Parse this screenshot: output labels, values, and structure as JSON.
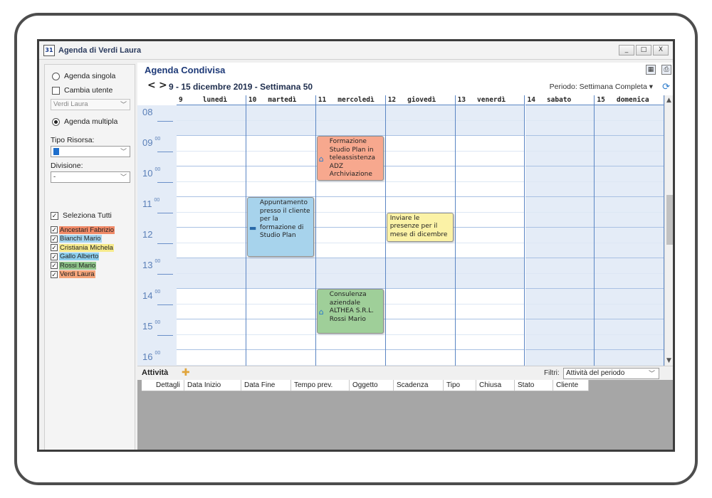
{
  "window": {
    "title": "Agenda di Verdi Laura",
    "app_icon": "31",
    "controls": [
      "_",
      "□",
      "X"
    ]
  },
  "left_panel": {
    "agenda_singola": "Agenda singola",
    "cambia_utente": "Cambia utente",
    "utente_value": "Verdi Laura",
    "agenda_multipla": "Agenda multipla",
    "tipo_risorsa_label": "Tipo Risorsa:",
    "divisione_label": "Divisione:",
    "divisione_value": "-",
    "seleziona_tutti": "Seleziona Tutti",
    "resources": [
      {
        "name": "Ancestari Fabrizio",
        "color": "#f08a68"
      },
      {
        "name": "Bianchi Mario",
        "color": "#a6d4ee"
      },
      {
        "name": "Cristiania Michela",
        "color": "#f6ea8c"
      },
      {
        "name": "Gallo Alberto",
        "color": "#8fd0ee"
      },
      {
        "name": "Rossi Mario",
        "color": "#8ec48a"
      },
      {
        "name": "Verdi Laura",
        "color": "#f4a47a"
      }
    ]
  },
  "header": {
    "title": "Agenda Condivisa",
    "prev": "<",
    "next": ">",
    "date_range": "9 - 15 dicembre 2019 - Settimana 50",
    "periodo": "Periodo:  Settimana Completa ▾"
  },
  "calendar": {
    "days": [
      {
        "num": "9",
        "name": "lunedì"
      },
      {
        "num": "10",
        "name": "martedì"
      },
      {
        "num": "11",
        "name": "mercoledì"
      },
      {
        "num": "12",
        "name": "giovedì"
      },
      {
        "num": "13",
        "name": "venerdì"
      },
      {
        "num": "14",
        "name": "sabato"
      },
      {
        "num": "15",
        "name": "domenica"
      }
    ],
    "hours": [
      {
        "h": "08",
        "m": ""
      },
      {
        "h": "09",
        "m": "00"
      },
      {
        "h": "10",
        "m": "00"
      },
      {
        "h": "11",
        "m": "00"
      },
      {
        "h": "12",
        "m": ""
      },
      {
        "h": "13",
        "m": "00"
      },
      {
        "h": "14",
        "m": "00"
      },
      {
        "h": "15",
        "m": "00"
      },
      {
        "h": "16",
        "m": "00"
      }
    ],
    "events": [
      {
        "text": "Formazione Studio Plan in teleassistenza ADZ Archiviazione",
        "day": "11 mercoledì",
        "start": "09:00",
        "end": "10:30",
        "color": "#f7a88e",
        "icon": "home-icon"
      },
      {
        "text": "Appuntamento presso il cliente per la formazione di Studio Plan",
        "day": "10 martedì",
        "start": "11:00",
        "end": "13:00",
        "color": "#a7d3ec",
        "icon": "briefcase-icon"
      },
      {
        "text": "Inviare le presenze per il mese di dicembre",
        "day": "12 giovedì",
        "start": "11:30",
        "end": "12:30",
        "color": "#fbf2a6",
        "icon": ""
      },
      {
        "text": "Consulenza aziendale ALTHEA S.R.L. Rossi Mario",
        "day": "11 mercoledì",
        "start": "14:00",
        "end": "15:30",
        "color": "#9fcf99",
        "icon": "home-icon"
      }
    ]
  },
  "activity": {
    "title": "Attività",
    "filtri_label": "Filtri:",
    "filtri_value": "Attività del periodo",
    "columns": [
      "Dettagli",
      "Data Inizio",
      "Data Fine",
      "Tempo prev.",
      "Oggetto",
      "Scadenza",
      "Tipo",
      "Chiusa",
      "Stato",
      "Cliente"
    ]
  }
}
